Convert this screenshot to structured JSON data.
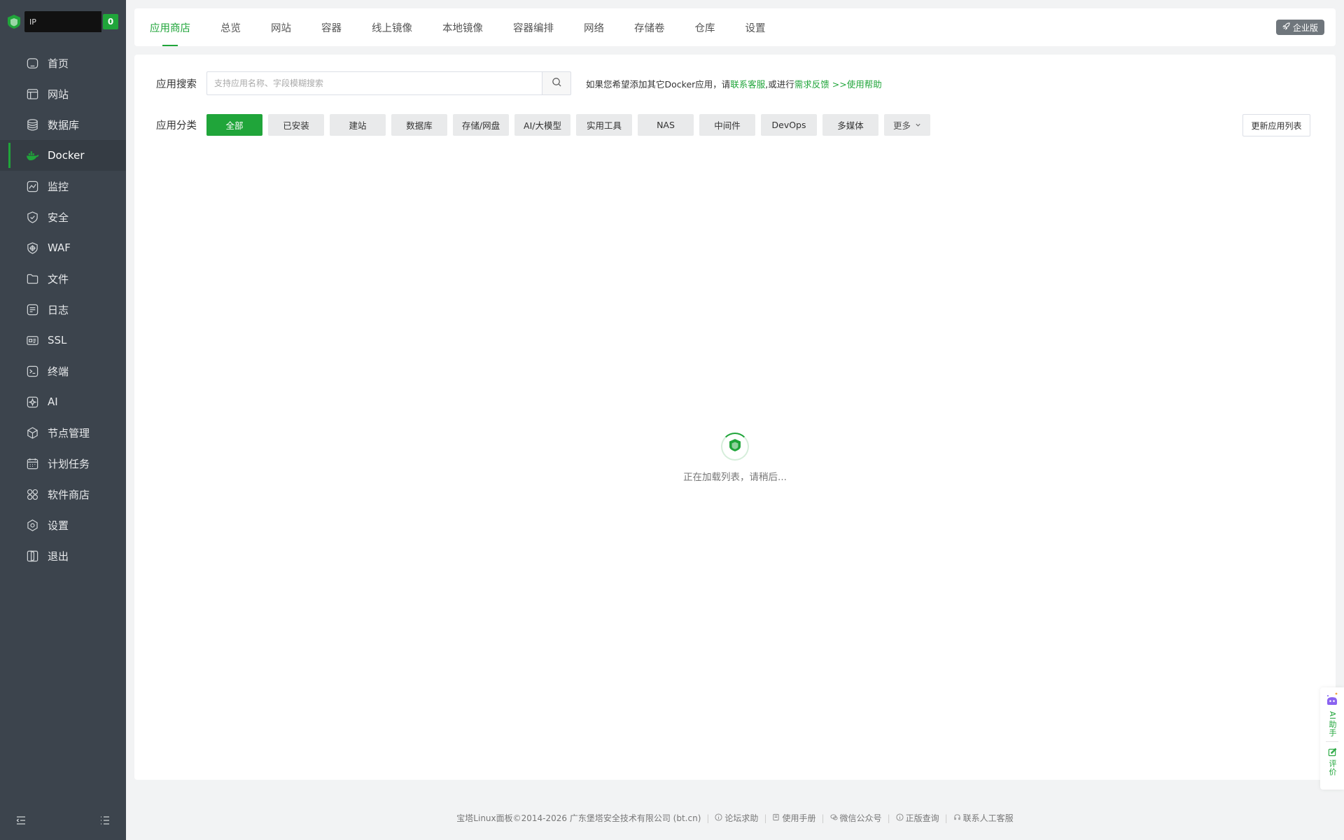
{
  "brand": {
    "ip_text": "IP",
    "count": "0"
  },
  "sidebar": {
    "items": [
      {
        "label": "首页",
        "icon": "home-icon"
      },
      {
        "label": "网站",
        "icon": "website-icon"
      },
      {
        "label": "数据库",
        "icon": "database-icon"
      },
      {
        "label": "Docker",
        "icon": "docker-icon",
        "active": true
      },
      {
        "label": "监控",
        "icon": "monitor-icon"
      },
      {
        "label": "安全",
        "icon": "shield-icon"
      },
      {
        "label": "WAF",
        "icon": "waf-icon"
      },
      {
        "label": "文件",
        "icon": "folder-icon"
      },
      {
        "label": "日志",
        "icon": "log-icon"
      },
      {
        "label": "SSL",
        "icon": "ssl-icon"
      },
      {
        "label": "终端",
        "icon": "terminal-icon"
      },
      {
        "label": "AI",
        "icon": "ai-icon"
      },
      {
        "label": "节点管理",
        "icon": "node-icon"
      },
      {
        "label": "计划任务",
        "icon": "calendar-icon"
      },
      {
        "label": "软件商店",
        "icon": "store-icon"
      },
      {
        "label": "设置",
        "icon": "settings-icon"
      },
      {
        "label": "退出",
        "icon": "logout-icon"
      }
    ]
  },
  "tabs": [
    "应用商店",
    "总览",
    "网站",
    "容器",
    "线上镜像",
    "本地镜像",
    "容器编排",
    "网络",
    "存储卷",
    "仓库",
    "设置"
  ],
  "enterprise_label": "企业版",
  "search": {
    "label": "应用搜索",
    "placeholder": "支持应用名称、字段模糊搜索",
    "hint_prefix": "如果您希望添加其它Docker应用，请",
    "hint_link1": "联系客服",
    "hint_mid": ",或进行",
    "hint_link2": "需求反馈",
    "hint_link3": " >>使用帮助"
  },
  "categories": {
    "label": "应用分类",
    "items": [
      "全部",
      "已安装",
      "建站",
      "数据库",
      "存储/网盘",
      "AI/大模型",
      "实用工具",
      "NAS",
      "中间件",
      "DevOps",
      "多媒体"
    ],
    "more": "更多",
    "update_button": "更新应用列表"
  },
  "loading_text": "正在加载列表，请稍后...",
  "float": {
    "ai": "AI助手",
    "review": "评价"
  },
  "footer": {
    "copyright": "宝塔Linux面板©2014-2026 广东堡塔安全技术有限公司 (bt.cn)",
    "links": [
      "论坛求助",
      "使用手册",
      "微信公众号",
      "正版查询",
      "联系人工客服"
    ]
  },
  "colors": {
    "accent": "#20a53a",
    "sidebar": "#3c444d"
  }
}
